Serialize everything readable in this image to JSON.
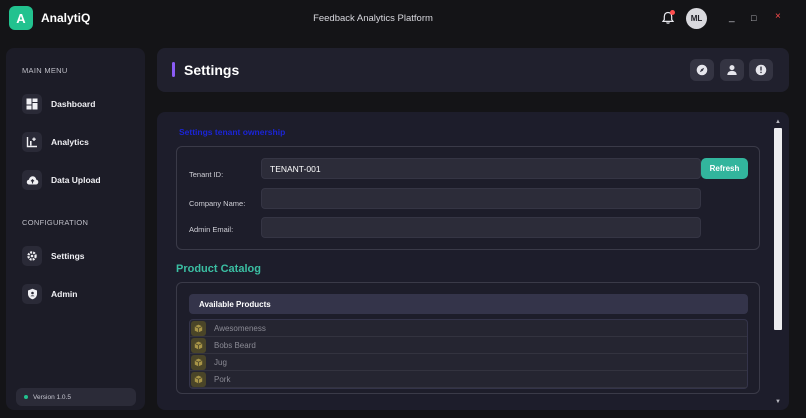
{
  "app": {
    "logo_letter": "A",
    "name": "AnalytiQ",
    "window_title": "Feedback Analytics Platform",
    "avatar_initials": "ML",
    "window_controls": {
      "minimize": "_",
      "maximize": "□",
      "close": "×"
    }
  },
  "sidebar": {
    "main_menu_label": "MAIN MENU",
    "main_items": [
      {
        "label": "Dashboard",
        "icon": "dashboard-icon"
      },
      {
        "label": "Analytics",
        "icon": "analytics-icon"
      },
      {
        "label": "Data Upload",
        "icon": "cloud-upload-icon"
      }
    ],
    "config_label": "CONFIGURATION",
    "config_items": [
      {
        "label": "Settings",
        "icon": "gear-icon"
      },
      {
        "label": "Admin",
        "icon": "shield-icon"
      }
    ],
    "version": "Version 1.0.5"
  },
  "header": {
    "title": "Settings",
    "buttons": [
      "compass-icon",
      "user-icon",
      "info-icon"
    ]
  },
  "tenant_section": {
    "title": "Settings tenant ownership",
    "tenant_id_label": "Tenant ID:",
    "tenant_id_value": "TENANT-001",
    "refresh_label": "Refresh",
    "company_name_label": "Company Name:",
    "company_name_value": "",
    "admin_email_label": "Admin Email:",
    "admin_email_value": ""
  },
  "catalog": {
    "title": "Product Catalog",
    "header": "Available Products",
    "products": [
      "Awesomeness",
      "Bobs Beard",
      "Jug",
      "Pork"
    ]
  },
  "colors": {
    "accent_green": "#22c28f",
    "accent_purple": "#8b5cf6",
    "teal": "#3bbfa3",
    "notification": "#ff4d4d"
  }
}
